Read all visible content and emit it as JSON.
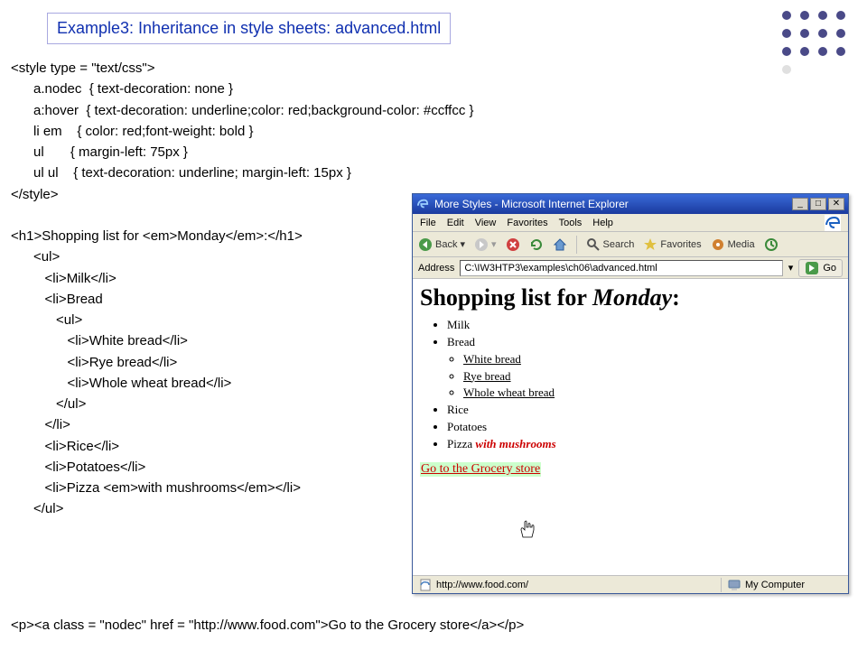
{
  "header": {
    "title": "Example3: Inheritance in style sheets: advanced.html"
  },
  "code": {
    "l1": "<style type = \"text/css\">",
    "l2": "      a.nodec  { text-decoration: none }",
    "l3": "      a:hover  { text-decoration: underline;color: red;background-color: #ccffcc }",
    "l4": "      li em    { color: red;font-weight: bold }",
    "l5": "      ul       { margin-left: 75px }",
    "l6": "      ul ul    { text-decoration: underline; margin-left: 15px }",
    "l7": "</style>",
    "l8": "",
    "l9": "<h1>Shopping list for <em>Monday</em>:</h1>",
    "l10": "      <ul>",
    "l11": "         <li>Milk</li>",
    "l12": "         <li>Bread",
    "l13": "            <ul>",
    "l14": "               <li>White bread</li>",
    "l15": "               <li>Rye bread</li>",
    "l16": "               <li>Whole wheat bread</li>",
    "l17": "            </ul>",
    "l18": "         </li>",
    "l19": "         <li>Rice</li>",
    "l20": "         <li>Potatoes</li>",
    "l21": "         <li>Pizza <em>with mushrooms</em></li>",
    "l22": "      </ul>",
    "l23": "",
    "last": "      <p><a class = \"nodec\" href = \"http://www.food.com\">Go to the Grocery store</a></p>"
  },
  "browser": {
    "title": "More Styles - Microsoft Internet Explorer",
    "menu": {
      "file": "File",
      "edit": "Edit",
      "view": "View",
      "favorites": "Favorites",
      "tools": "Tools",
      "help": "Help"
    },
    "toolbar": {
      "back": "Back",
      "search": "Search",
      "favoritesBtn": "Favorites",
      "media": "Media"
    },
    "address": {
      "label": "Address",
      "value": "C:\\IW3HTP3\\examples\\ch06\\advanced.html",
      "go": "Go"
    },
    "page": {
      "heading_prefix": "Shopping list for ",
      "heading_em": "Monday",
      "heading_suffix": ":",
      "items": {
        "milk": "Milk",
        "bread": "Bread",
        "white": "White bread",
        "rye": "Rye bread",
        "whole": "Whole wheat bread",
        "rice": "Rice",
        "potatoes": "Potatoes",
        "pizza": "Pizza ",
        "pizza_em": "with mushrooms"
      },
      "link": "Go to the Grocery store"
    },
    "status": {
      "left": "http://www.food.com/",
      "right": "My Computer"
    }
  }
}
